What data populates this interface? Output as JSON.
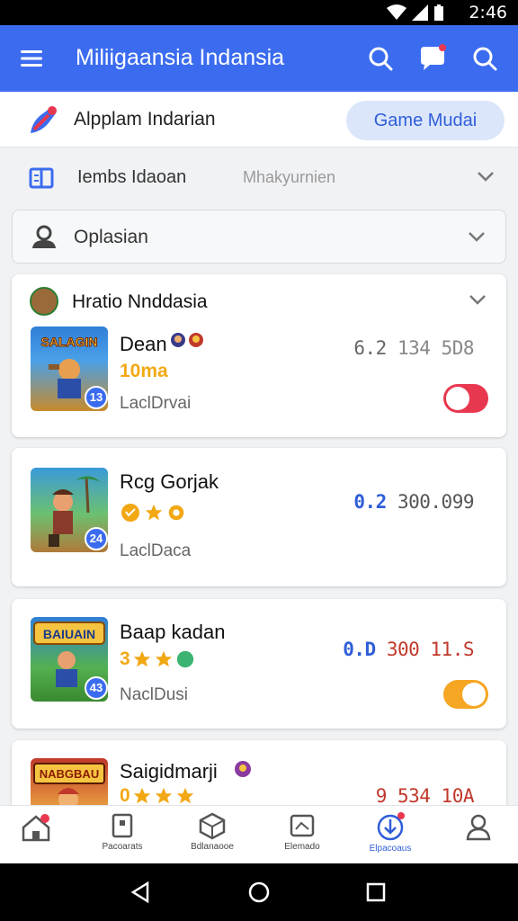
{
  "status_bar": {
    "time": "2:46"
  },
  "app_bar": {
    "title": "Miliigaansia Indansia"
  },
  "sub_header": {
    "label": "Alpplam Indarian",
    "mode_button": "Game Mudai"
  },
  "filter": {
    "label": "Iembs Idaoan",
    "value": "Mhakyurnien"
  },
  "select": {
    "label": "Oplasian"
  },
  "section": {
    "title": "Hratio Nnddasia",
    "games": [
      {
        "name": "Dean",
        "subtitle": "10ma",
        "tag": "LaclDrvai",
        "stat_hl": "6.2",
        "stat_rest": "134 5D8",
        "badge": "13",
        "thumb_text": "SALAGIN",
        "toggle": "on"
      },
      {
        "name": "Rcg Gorjak",
        "subtitle": "",
        "tag": "LaclDaca",
        "stat_hl": "0.2",
        "stat_rest": "300.099",
        "badge": "24",
        "thumb_text": "",
        "toggle": "none"
      },
      {
        "name": "Baap kadan",
        "subtitle": "3",
        "tag": "NaclDusi",
        "stat_hl": "0.D",
        "stat_rest": "300 11.S",
        "badge": "43",
        "thumb_text": "BAIUAIN",
        "toggle": "off"
      },
      {
        "name": "Saigidmarji",
        "subtitle": "0",
        "tag": "",
        "stat_hl": "",
        "stat_rest": "9 534 10A",
        "badge": "",
        "thumb_text": "NABGBAU",
        "toggle": "none"
      }
    ]
  },
  "bottom_nav": [
    {
      "label": ""
    },
    {
      "label": "Pacoarats"
    },
    {
      "label": "Bdlanaooe"
    },
    {
      "label": "Elemado"
    },
    {
      "label": "Elpacoaus"
    },
    {
      "label": ""
    }
  ],
  "colors": {
    "primary": "#3b6cf0",
    "accent_toggle_on": "#e8384f",
    "accent_toggle_off": "#f5a623",
    "star": "#f2a814"
  }
}
